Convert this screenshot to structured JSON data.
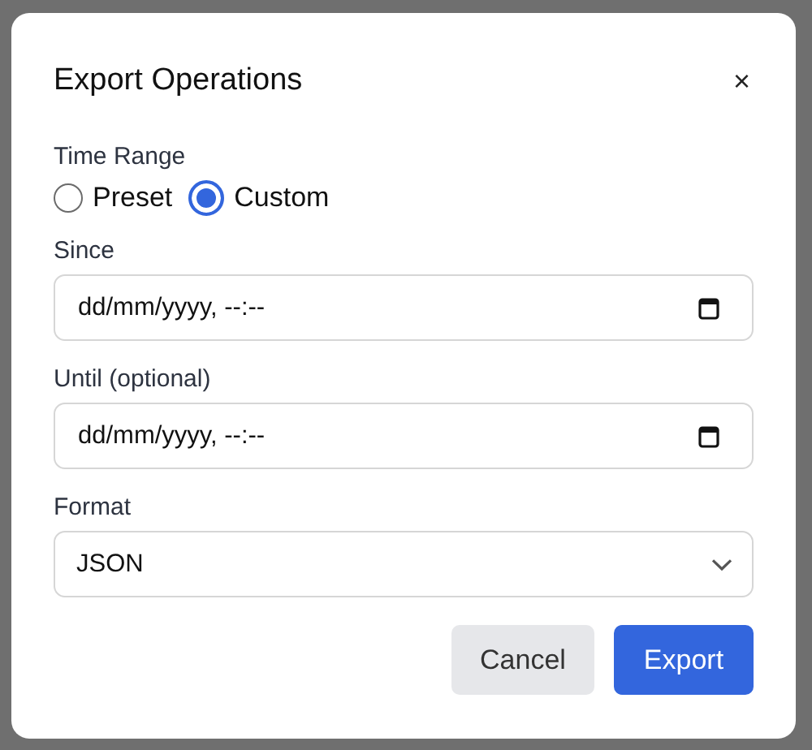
{
  "dialog": {
    "title": "Export Operations",
    "close": "×"
  },
  "time_range": {
    "label": "Time Range",
    "options": [
      {
        "label": "Preset",
        "selected": false
      },
      {
        "label": "Custom",
        "selected": true
      }
    ]
  },
  "fields": [
    {
      "kind": "datetime",
      "label": "Since",
      "placeholder": "dd/mm/yyyy, --:--"
    },
    {
      "kind": "datetime",
      "label": "Until (optional)",
      "placeholder": "dd/mm/yyyy, --:--"
    },
    {
      "kind": "select",
      "label": "Format",
      "value": "JSON"
    }
  ],
  "buttons": [
    {
      "kind": "secondary",
      "label": "Cancel"
    },
    {
      "kind": "primary",
      "label": "Export"
    }
  ]
}
